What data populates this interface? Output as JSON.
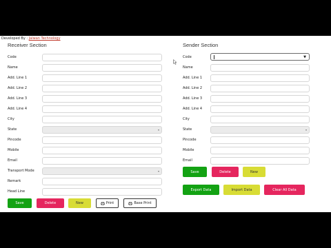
{
  "developer": {
    "prefix": "Developed By : ",
    "name": "Jalwan Technology"
  },
  "receiver": {
    "title": "Receiver Section",
    "fields": [
      {
        "label": "Code"
      },
      {
        "label": "Name"
      },
      {
        "label": "Add. Line 1"
      },
      {
        "label": "Add. Line 2"
      },
      {
        "label": "Add. Line 3"
      },
      {
        "label": "Add. Line 4"
      },
      {
        "label": "City"
      },
      {
        "label": "State"
      },
      {
        "label": "Pincode"
      },
      {
        "label": "Mobile"
      },
      {
        "label": "Email"
      },
      {
        "label": "Transport Mode"
      },
      {
        "label": "Remark"
      },
      {
        "label": "Head Line"
      }
    ],
    "buttons": {
      "save": "Save",
      "delete": "Delete",
      "new": "New",
      "print": "Print",
      "base_print": "Base Print"
    }
  },
  "sender": {
    "title": "Sender Section",
    "fields": [
      {
        "label": "Code"
      },
      {
        "label": "Name"
      },
      {
        "label": "Add. Line 1"
      },
      {
        "label": "Add. Line 2"
      },
      {
        "label": "Add. Line 3"
      },
      {
        "label": "Add. Line 4"
      },
      {
        "label": "City"
      },
      {
        "label": "State"
      },
      {
        "label": "Pincode"
      },
      {
        "label": "Mobile"
      },
      {
        "label": "Email"
      }
    ],
    "buttons": {
      "save": "Save",
      "delete": "Delete",
      "new": "New"
    },
    "data_buttons": {
      "export": "Export Data",
      "import": "Import Data",
      "clear": "Clear All Data"
    }
  },
  "colors": {
    "save": "#13a213",
    "delete": "#e5265e",
    "new": "#d8dc35"
  },
  "icons": {
    "print": "printer-icon",
    "base_print": "printer-icon",
    "cursor": "mouse-pointer-icon",
    "dropdown": "chevron-down-icon"
  }
}
